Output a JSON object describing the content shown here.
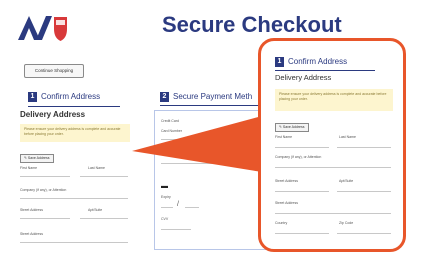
{
  "header": {
    "title": "Secure Checkout",
    "continue_label": "Continue Shopping"
  },
  "steps": {
    "confirm": {
      "num": "1",
      "label": "Confirm Address"
    },
    "payment": {
      "num": "2",
      "label": "Secure Payment Meth"
    }
  },
  "address": {
    "heading": "Delivery Address",
    "note": "Please ensure your delivery address is complete and accurate before placing your order.",
    "button": "Save Address",
    "fields": [
      "First Name",
      "Last Name",
      "Company (if any), or Attention",
      "Street Address",
      "Apt/Suite",
      "Street Address",
      "Country",
      "Zip Code"
    ]
  },
  "payment": {
    "card_name": "Credit Card",
    "label_number": "Card Number",
    "label_exp": "Expiry",
    "label_cvv": "CVV",
    "slash": "/"
  },
  "colors": {
    "accent": "#2b3a80",
    "callout": "#e8562a",
    "note_bg": "#fdf5cf"
  }
}
